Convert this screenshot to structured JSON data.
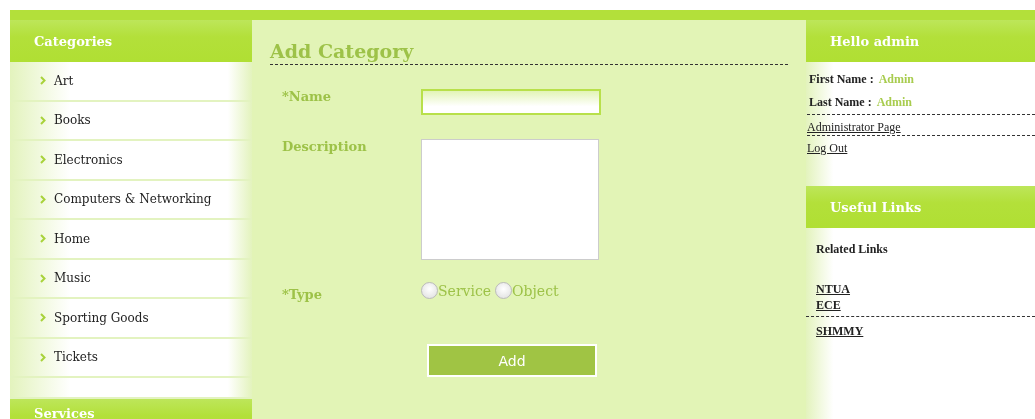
{
  "categories": {
    "title": "Categories",
    "items": [
      {
        "label": "Art"
      },
      {
        "label": "Books"
      },
      {
        "label": "Electronics"
      },
      {
        "label": "Computers & Networking"
      },
      {
        "label": "Home"
      },
      {
        "label": "Music"
      },
      {
        "label": "Sporting Goods"
      },
      {
        "label": "Tickets"
      }
    ]
  },
  "services": {
    "title": "Services"
  },
  "form": {
    "title": "Add Category",
    "name_label": "*Name",
    "description_label": "Description",
    "type_label": "*Type",
    "type_options": [
      {
        "label": "Service",
        "selected": false
      },
      {
        "label": "Object",
        "selected": false
      }
    ],
    "submit": "Add"
  },
  "user_panel": {
    "title": "Hello admin",
    "fields": [
      {
        "label": "First Name :",
        "value": "Admin"
      },
      {
        "label": "Last Name :",
        "value": "Admin"
      }
    ],
    "links": [
      "Administrator Page",
      "Log Out"
    ]
  },
  "useful_links": {
    "title": "Useful Links",
    "subtitle": "Related Links",
    "groups": [
      [
        "NTUA",
        "ECE"
      ],
      [
        "SHMMY"
      ]
    ]
  }
}
